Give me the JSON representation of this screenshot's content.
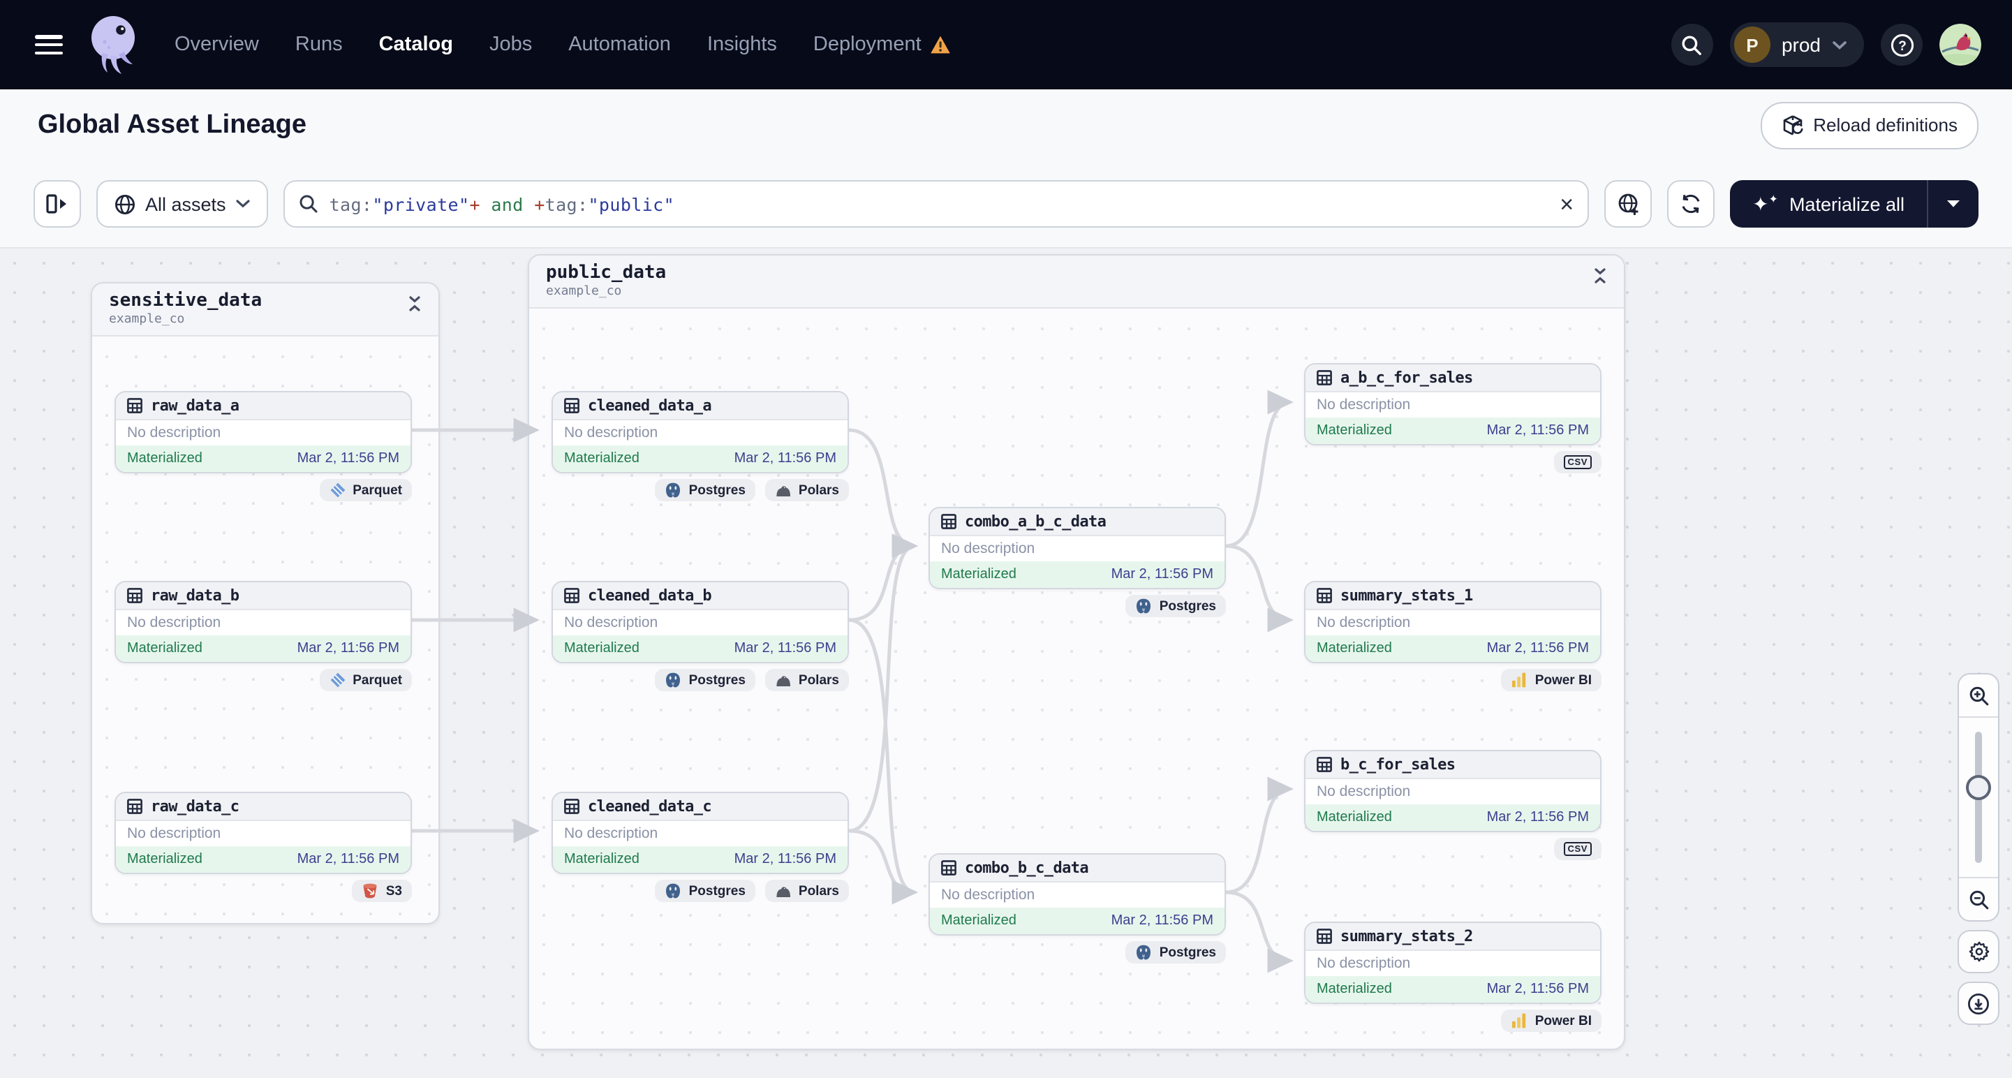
{
  "navbar": {
    "items": [
      {
        "label": "Overview"
      },
      {
        "label": "Runs"
      },
      {
        "label": "Catalog"
      },
      {
        "label": "Jobs"
      },
      {
        "label": "Automation"
      },
      {
        "label": "Insights"
      },
      {
        "label": "Deployment"
      }
    ],
    "active_item": "Catalog",
    "deployment_has_warning": true,
    "env_switcher": {
      "avatar_letter": "P",
      "label": "prod"
    },
    "icons": [
      "hamburger-icon",
      "dagster-logo",
      "warning-icon",
      "search-icon",
      "help-icon",
      "user-avatar"
    ]
  },
  "page_header": {
    "title": "Global Asset Lineage",
    "reload_definitions_label": "Reload definitions"
  },
  "toolbar": {
    "asset_scope_label": "All assets",
    "search": {
      "segments": [
        {
          "text": "tag:"
        },
        {
          "text": "\"private\""
        },
        {
          "text": "+"
        },
        {
          "text": " and "
        },
        {
          "text": "+"
        },
        {
          "text": "tag:"
        },
        {
          "text": "\"public\""
        }
      ]
    },
    "materialize_label": "Materialize all"
  },
  "graph": {
    "groups": [
      {
        "name": "sensitive_data",
        "location": "example_co"
      },
      {
        "name": "public_data",
        "location": "example_co"
      }
    ],
    "nodes": [
      {
        "name": "raw_data_a",
        "description": "No description",
        "status": "Materialized",
        "timestamp": "Mar 2, 11:56 PM",
        "badges": [
          "Parquet"
        ]
      },
      {
        "name": "raw_data_b",
        "description": "No description",
        "status": "Materialized",
        "timestamp": "Mar 2, 11:56 PM",
        "badges": [
          "Parquet"
        ]
      },
      {
        "name": "raw_data_c",
        "description": "No description",
        "status": "Materialized",
        "timestamp": "Mar 2, 11:56 PM",
        "badges": [
          "S3"
        ]
      },
      {
        "name": "cleaned_data_a",
        "description": "No description",
        "status": "Materialized",
        "timestamp": "Mar 2, 11:56 PM",
        "badges": [
          "Postgres",
          "Polars"
        ]
      },
      {
        "name": "cleaned_data_b",
        "description": "No description",
        "status": "Materialized",
        "timestamp": "Mar 2, 11:56 PM",
        "badges": [
          "Postgres",
          "Polars"
        ]
      },
      {
        "name": "cleaned_data_c",
        "description": "No description",
        "status": "Materialized",
        "timestamp": "Mar 2, 11:56 PM",
        "badges": [
          "Postgres",
          "Polars"
        ]
      },
      {
        "name": "combo_a_b_c_data",
        "description": "No description",
        "status": "Materialized",
        "timestamp": "Mar 2, 11:56 PM",
        "badges": [
          "Postgres"
        ]
      },
      {
        "name": "combo_b_c_data",
        "description": "No description",
        "status": "Materialized",
        "timestamp": "Mar 2, 11:56 PM",
        "badges": [
          "Postgres"
        ]
      },
      {
        "name": "a_b_c_for_sales",
        "description": "No description",
        "status": "Materialized",
        "timestamp": "Mar 2, 11:56 PM",
        "badges": [
          "csv"
        ]
      },
      {
        "name": "summary_stats_1",
        "description": "No description",
        "status": "Materialized",
        "timestamp": "Mar 2, 11:56 PM",
        "badges": [
          "Power BI"
        ]
      },
      {
        "name": "b_c_for_sales",
        "description": "No description",
        "status": "Materialized",
        "timestamp": "Mar 2, 11:56 PM",
        "badges": [
          "csv"
        ]
      },
      {
        "name": "summary_stats_2",
        "description": "No description",
        "status": "Materialized",
        "timestamp": "Mar 2, 11:56 PM",
        "badges": [
          "Power BI"
        ]
      }
    ],
    "edges": [
      "raw_data_a->cleaned_data_a",
      "raw_data_b->cleaned_data_b",
      "raw_data_c->cleaned_data_c",
      "cleaned_data_a->combo_a_b_c_data",
      "cleaned_data_b->combo_a_b_c_data",
      "cleaned_data_c->combo_a_b_c_data",
      "cleaned_data_b->combo_b_c_data",
      "cleaned_data_c->combo_b_c_data",
      "combo_a_b_c_data->a_b_c_for_sales",
      "combo_a_b_c_data->summary_stats_1",
      "combo_b_c_data->b_c_for_sales",
      "combo_b_c_data->summary_stats_2"
    ],
    "status_colors": {
      "materialized_bg": "#e7f6ed",
      "materialized_text": "#1f7a4c",
      "timestamp_text": "#3c3f8e"
    }
  },
  "canvas_controls": {
    "icons": [
      "zoom-in-icon",
      "zoom-out-icon",
      "zoom-slider",
      "settings-gear-icon",
      "download-icon"
    ]
  }
}
